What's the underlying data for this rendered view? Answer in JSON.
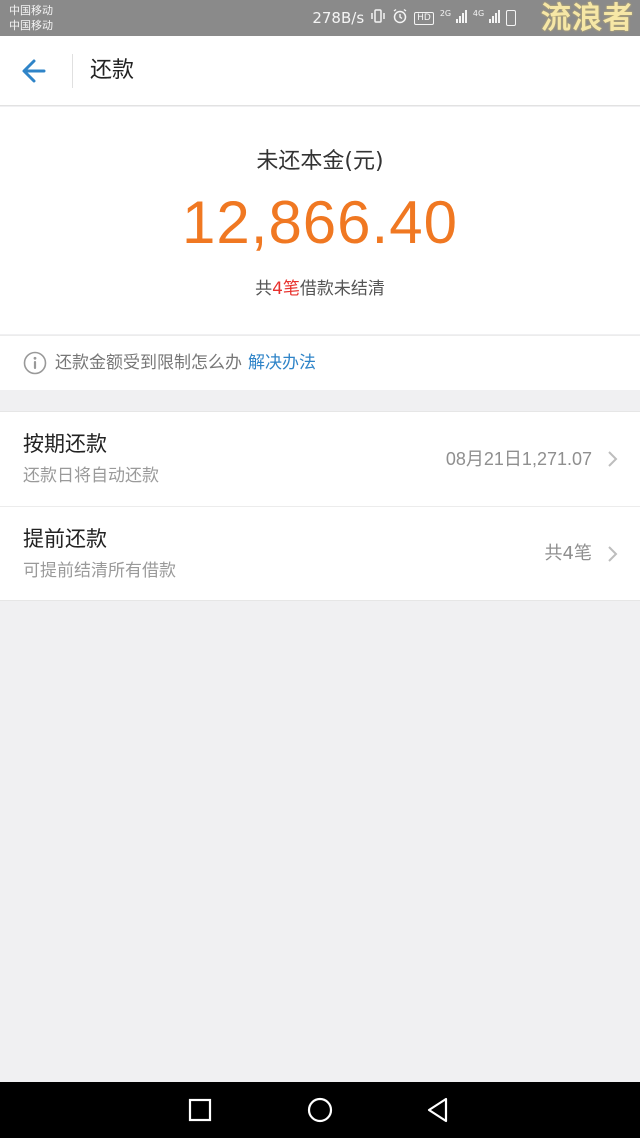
{
  "status_bar": {
    "carrier_1": "中国移动",
    "carrier_2": "中国移动",
    "net_speed": "278B/s",
    "signal_1_gen": "2G",
    "signal_2_gen": "4G",
    "hd_label": "HD",
    "watermark": "流浪者",
    "icons": [
      "vibrate-icon",
      "alarm-icon",
      "hd-icon",
      "signal-icon",
      "signal-icon",
      "battery-icon"
    ]
  },
  "header": {
    "title": "还款",
    "back_icon": "arrow-left-icon",
    "accent_color": "#2f84c8"
  },
  "summary": {
    "label": "未还本金(元)",
    "amount": "12,866.40",
    "amount_color": "#f07822",
    "count_prefix": "共",
    "count_num": "4笔",
    "count_suffix": "借款未结清",
    "count_color": "#e8322e"
  },
  "notice": {
    "icon": "info-icon",
    "text": "还款金额受到限制怎么办",
    "link": "解决办法"
  },
  "list": [
    {
      "title": "按期还款",
      "subtitle": "还款日将自动还款",
      "value": "08月21日1,271.07"
    },
    {
      "title": "提前还款",
      "subtitle": "可提前结清所有借款",
      "value": "共4笔"
    }
  ],
  "nav_bar": {
    "icons": [
      "recent-apps-icon",
      "home-icon",
      "back-icon"
    ]
  }
}
